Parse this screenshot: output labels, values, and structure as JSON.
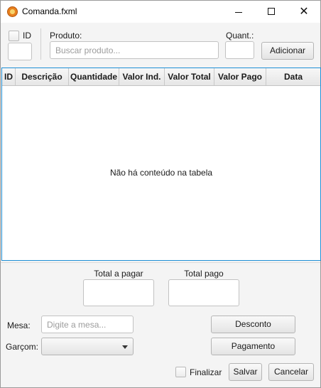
{
  "window": {
    "title": "Comanda.fxml"
  },
  "top": {
    "id_label": "ID",
    "produto_label": "Produto:",
    "produto_placeholder": "Buscar produto...",
    "quant_label": "Quant.:",
    "adicionar_label": "Adicionar"
  },
  "table": {
    "columns": [
      "ID",
      "Descrição",
      "Quantidade",
      "Valor Ind.",
      "Valor Total",
      "Valor Pago",
      "Data"
    ],
    "empty_message": "Não há conteúdo na tabela"
  },
  "totals": {
    "total_a_pagar_label": "Total a pagar",
    "total_pago_label": "Total pago"
  },
  "form": {
    "mesa_label": "Mesa:",
    "mesa_placeholder": "Digite a mesa...",
    "garcom_label": "Garçom:",
    "desconto_label": "Desconto",
    "pagamento_label": "Pagamento",
    "finalizar_label": "Finalizar",
    "salvar_label": "Salvar",
    "cancelar_label": "Cancelar"
  },
  "colors": {
    "accent": "#1e8fd6",
    "app_icon": "#e8801e"
  }
}
